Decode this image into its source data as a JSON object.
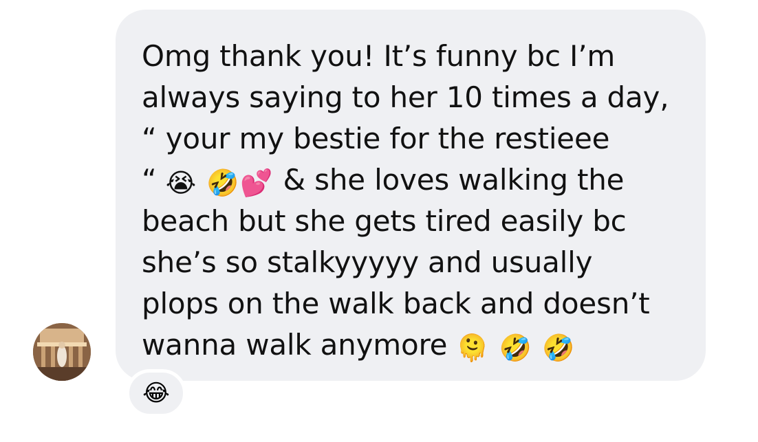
{
  "avatar": {
    "icon": "profile-photo"
  },
  "message": {
    "lines": [
      [
        "Omg thank you! It’s funny bc I’m"
      ],
      [
        "always saying to her 10 times a day,"
      ],
      [
        "“ your my bestie for the restieee"
      ],
      [
        "“ ",
        "😭",
        " ",
        "🤣",
        "💕",
        "  & she loves walking the"
      ],
      [
        "beach but she gets tired easily bc"
      ],
      [
        "she’s so stalkyyyyy and usually"
      ],
      [
        "plops on the walk back and doesn’t"
      ],
      [
        "wanna walk anymore ",
        "🫠",
        " ",
        "🤣",
        " ",
        "🤣"
      ]
    ],
    "text_1": "Omg thank you! It’s funny bc I’m",
    "text_2": "always saying to her 10 times a day,",
    "text_3": "“ your my bestie for the restieee",
    "text_4a": "“ ",
    "emoji_4a": "😭",
    "emoji_4b": "🤣",
    "emoji_4c": "💕",
    "text_4b": "  & she loves walking the",
    "text_5": "beach but she gets tired easily bc",
    "text_6": "she’s so stalkyyyyy and usually",
    "text_7": "plops on the walk back and doesn’t",
    "text_8": "wanna walk anymore ",
    "emoji_8a": "🫠",
    "emoji_8b": "🤣",
    "emoji_8c": "🤣"
  },
  "reaction": {
    "emoji": "😂"
  },
  "colors": {
    "bubble": "#eff0f3",
    "text": "#111111",
    "background": "#ffffff"
  }
}
